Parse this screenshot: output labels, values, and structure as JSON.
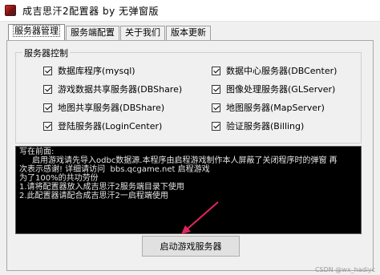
{
  "window": {
    "title": "成吉思汗2配置器 by 无弹窗版"
  },
  "tabs": [
    {
      "label": "服务器管理",
      "active": true
    },
    {
      "label": "服务端配置",
      "active": false
    },
    {
      "label": "关于我们",
      "active": false
    },
    {
      "label": "版本更新",
      "active": false
    }
  ],
  "server_group": {
    "title": "服务器控制",
    "left_items": [
      {
        "label": "数据库程序(mysql)",
        "checked": true
      },
      {
        "label": "游戏数据共享服务器(DBShare)",
        "checked": true
      },
      {
        "label": "地图共享服务器(DBShare)",
        "checked": true
      },
      {
        "label": "登陆服务器(LoginCenter)",
        "checked": true
      }
    ],
    "right_items": [
      {
        "label": "数据中心服务器(DBCenter)",
        "checked": true
      },
      {
        "label": "图像处理服务器(GLServer)",
        "checked": true
      },
      {
        "label": "地图服务器(MapServer)",
        "checked": true
      },
      {
        "label": "验证服务器(Billing)",
        "checked": true
      }
    ]
  },
  "console": {
    "lines": [
      "写在前面:",
      "启用游戏请先导入odbc数据源.本程序由启程游戏制作本人屏蔽了关闭程序时的弹窗 再",
      "次表示感谢! 详细请访问  bbs.qcgame.net 启程游戏",
      "为了100%的共功劳份",
      "1.请将配置器放入成吉思汗2服务端目录下使用",
      "2.此配置器请配合成吉思汗2一启程端使用"
    ]
  },
  "start_button": {
    "label": "启动游戏服务器"
  },
  "watermark": "CSDN @wx_hadiyc",
  "colors": {
    "arrow": "#e0245e",
    "console_bg": "#000000",
    "console_text": "#e6e6e6"
  }
}
